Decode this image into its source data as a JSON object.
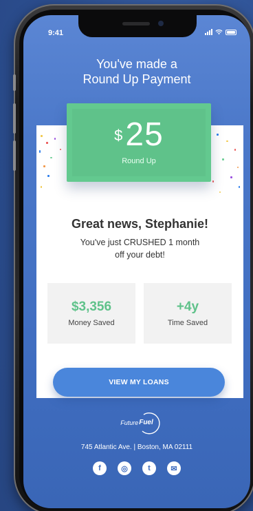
{
  "status_bar": {
    "time": "9:41"
  },
  "header": {
    "line1": "You've made a",
    "line2": "Round Up Payment"
  },
  "payment": {
    "currency": "$",
    "amount": "25",
    "caption": "Round Up"
  },
  "message": {
    "greeting": "Great news, Stephanie!",
    "line1": "You've just CRUSHED 1 month",
    "line2": "off your debt!"
  },
  "stats": [
    {
      "value": "$3,356",
      "label": "Money Saved"
    },
    {
      "value": "+4y",
      "label": "Time Saved"
    }
  ],
  "cta": {
    "label": "VIEW MY LOANS"
  },
  "footer": {
    "logo_future": "Future",
    "logo_fuel": "Fuel",
    "address": "745 Atlantic Ave. |  Boston, MA 02111",
    "socials": [
      {
        "icon": "facebook-icon",
        "glyph": "f"
      },
      {
        "icon": "instagram-icon",
        "glyph": "◎"
      },
      {
        "icon": "twitter-icon",
        "glyph": "t"
      },
      {
        "icon": "email-icon",
        "glyph": "✉"
      }
    ]
  },
  "colors": {
    "accent_green": "#5fc28a",
    "button_blue": "#4a86db",
    "background_blue": "#3f6dc0"
  }
}
